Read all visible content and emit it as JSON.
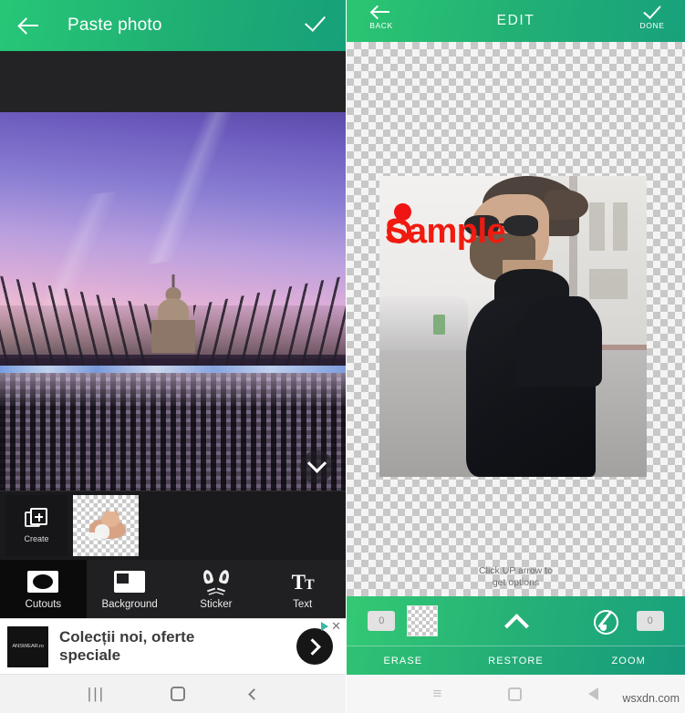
{
  "left_phone": {
    "header": {
      "title": "Paste photo",
      "back_icon": "arrow-left-icon",
      "confirm_icon": "check-icon"
    },
    "photo": {
      "description": "Millennium Bridge with St Paul's Cathedral at sunset",
      "expand_icon": "chevron-down-icon"
    },
    "cutouts_strip": {
      "create_label": "Create",
      "create_icon": "add-layer-icon",
      "thumbnail_name": "cat-cutout-thumbnail"
    },
    "tools": [
      {
        "label": "Cutouts",
        "icon": "cutouts-icon",
        "active": true
      },
      {
        "label": "Background",
        "icon": "background-icon",
        "active": false
      },
      {
        "label": "Sticker",
        "icon": "cat-face-sticker-icon",
        "active": false
      },
      {
        "label": "Text",
        "icon": "text-icon",
        "active": false
      }
    ],
    "ad": {
      "logo_text": "ANSWEAR.ro",
      "line1": "Colecții noi, oferte",
      "line2": "speciale",
      "cta_icon": "chevron-right-icon",
      "adchoices_icon": "adchoices-icon",
      "close_icon": "close-icon"
    },
    "nav": {
      "recents_icon": "recents-icon",
      "recents_glyph": "|||",
      "home_icon": "home-icon",
      "back_icon": "back-icon"
    }
  },
  "right_phone": {
    "header": {
      "title": "EDIT",
      "back_label": "BACK",
      "back_icon": "arrow-left-icon",
      "done_label": "DONE",
      "done_icon": "check-icon"
    },
    "canvas": {
      "photo_description": "Man in black turtleneck with glasses on a street",
      "watermark_text": "Sample",
      "watermark_color": "#ef1b10",
      "marker_dot_color": "#f01414",
      "hint_line1": "Click UP arrow to",
      "hint_line2": "get options"
    },
    "toolbar": {
      "erase_badge": "0",
      "swatch_name": "transparency-swatch",
      "up_arrow_icon": "chevron-up-icon",
      "brush_icon": "brush-icon",
      "zoom_badge": "0",
      "labels": [
        "ERASE",
        "RESTORE",
        "ZOOM"
      ]
    },
    "nav": {
      "menu_icon": "menu-icon",
      "menu_glyph": "≡",
      "square_icon": "home-square-icon",
      "back_icon": "back-triangle-icon"
    },
    "watermark": "wsxdn.com"
  },
  "colors": {
    "green_start": "#2bc672",
    "green_end": "#18a17c",
    "dark_panel": "#222224",
    "accent_red": "#ef1b10"
  }
}
